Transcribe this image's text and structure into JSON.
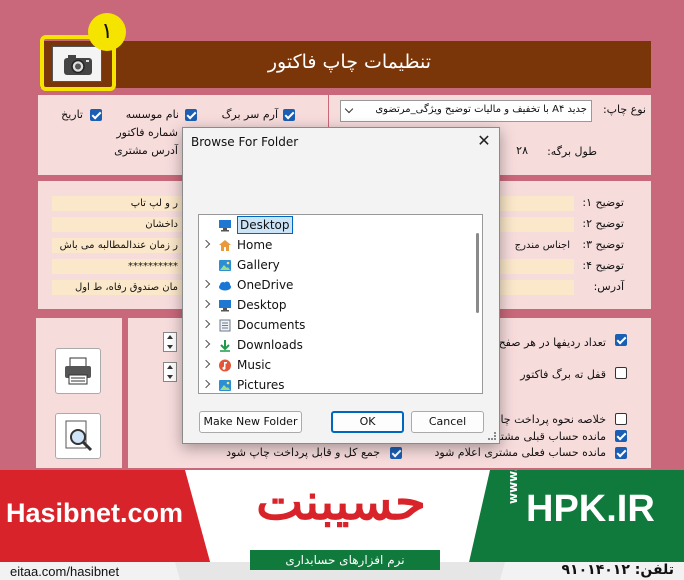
{
  "header": {
    "title": "تنظیمات چاپ فاکتور",
    "badge_number": "١"
  },
  "options_top": {
    "checkboxes": [
      {
        "label": "آرم سر برگ",
        "checked": true
      },
      {
        "label": "نام موسسه",
        "checked": true
      },
      {
        "label": "تاریخ",
        "checked": true
      },
      {
        "label": "شماره فاکتور",
        "checked": false
      },
      {
        "label": "آدرس مشتری",
        "checked": false
      }
    ]
  },
  "print_type": {
    "label": "نوع چاپ:",
    "value": "جدید A۴ با تخفیف و مالیات توضیح ویژگی_مرتضوی",
    "page_length_label": "طول برگه:",
    "page_length_value": "۲۸"
  },
  "descriptions": {
    "labels": [
      "توضیح ۱:",
      "توضیح ۲:",
      "توضیح ۳:",
      "توضیح ۴:",
      "آدرس:"
    ],
    "values": [
      "ر و لپ تاپ",
      "داخشان",
      "اجناس مندرج",
      "ر زمان عندالمطالبه می باش",
      "**********",
      "مان صندوق رفاه، ط اول"
    ]
  },
  "options_bottom": {
    "rows_label": "تعداد ردیفها در هر صفح",
    "lock_label": "قفل ته برگ فاکتور",
    "rows_checked": true,
    "lock_checked": false,
    "summary_items": [
      {
        "label": "خلاصه نحوه پرداخت چا",
        "checked": false
      },
      {
        "label": "مانده حساب قبلی مشتر",
        "checked": true
      },
      {
        "label": "مانده حساب فعلی مشتری اعلام شود",
        "checked": true
      },
      {
        "label": "جمع کل و قابل پرداخت چاپ شود",
        "checked": true
      }
    ]
  },
  "dialog": {
    "title": "Browse For Folder",
    "close": "✕",
    "items": [
      {
        "label": "Desktop",
        "icon": "desktop-icon",
        "color": "#1e78d2",
        "selected": true,
        "chevron": false
      },
      {
        "label": "Home",
        "icon": "home-icon",
        "color": "#e89a3c",
        "selected": false,
        "chevron": true
      },
      {
        "label": "Gallery",
        "icon": "gallery-icon",
        "color": "#2b8fd8",
        "selected": false,
        "chevron": false
      },
      {
        "label": "OneDrive",
        "icon": "cloud-icon",
        "color": "#1877d4",
        "selected": false,
        "chevron": true
      },
      {
        "label": "Desktop",
        "icon": "desktop-icon",
        "color": "#1e78d2",
        "selected": false,
        "chevron": true
      },
      {
        "label": "Documents",
        "icon": "documents-icon",
        "color": "#6c7a89",
        "selected": false,
        "chevron": true
      },
      {
        "label": "Downloads",
        "icon": "downloads-icon",
        "color": "#1f9a4a",
        "selected": false,
        "chevron": true
      },
      {
        "label": "Music",
        "icon": "music-icon",
        "color": "#e2563a",
        "selected": false,
        "chevron": true
      },
      {
        "label": "Pictures",
        "icon": "pictures-icon",
        "color": "#2b8fd8",
        "selected": false,
        "chevron": true
      }
    ],
    "make_new_folder": "Make New Folder",
    "ok": "OK",
    "cancel": "Cancel"
  },
  "banner": {
    "left_brand": "Hasibnet.com",
    "left_handle": "eitaa.com/hasibnet",
    "center_logo": "حسیبنت",
    "center_tagline": "نرم افزارهای حسابداری",
    "right_brand": "HPK.IR",
    "right_www": "www.",
    "phone": "تلفن: ۹۱۰۱۴۰۱۲"
  },
  "colors": {
    "header_bg": "#7a3509",
    "accent_yellow": "#f5e400",
    "banner_red": "#d9232a",
    "banner_green": "#0f7a3c"
  }
}
